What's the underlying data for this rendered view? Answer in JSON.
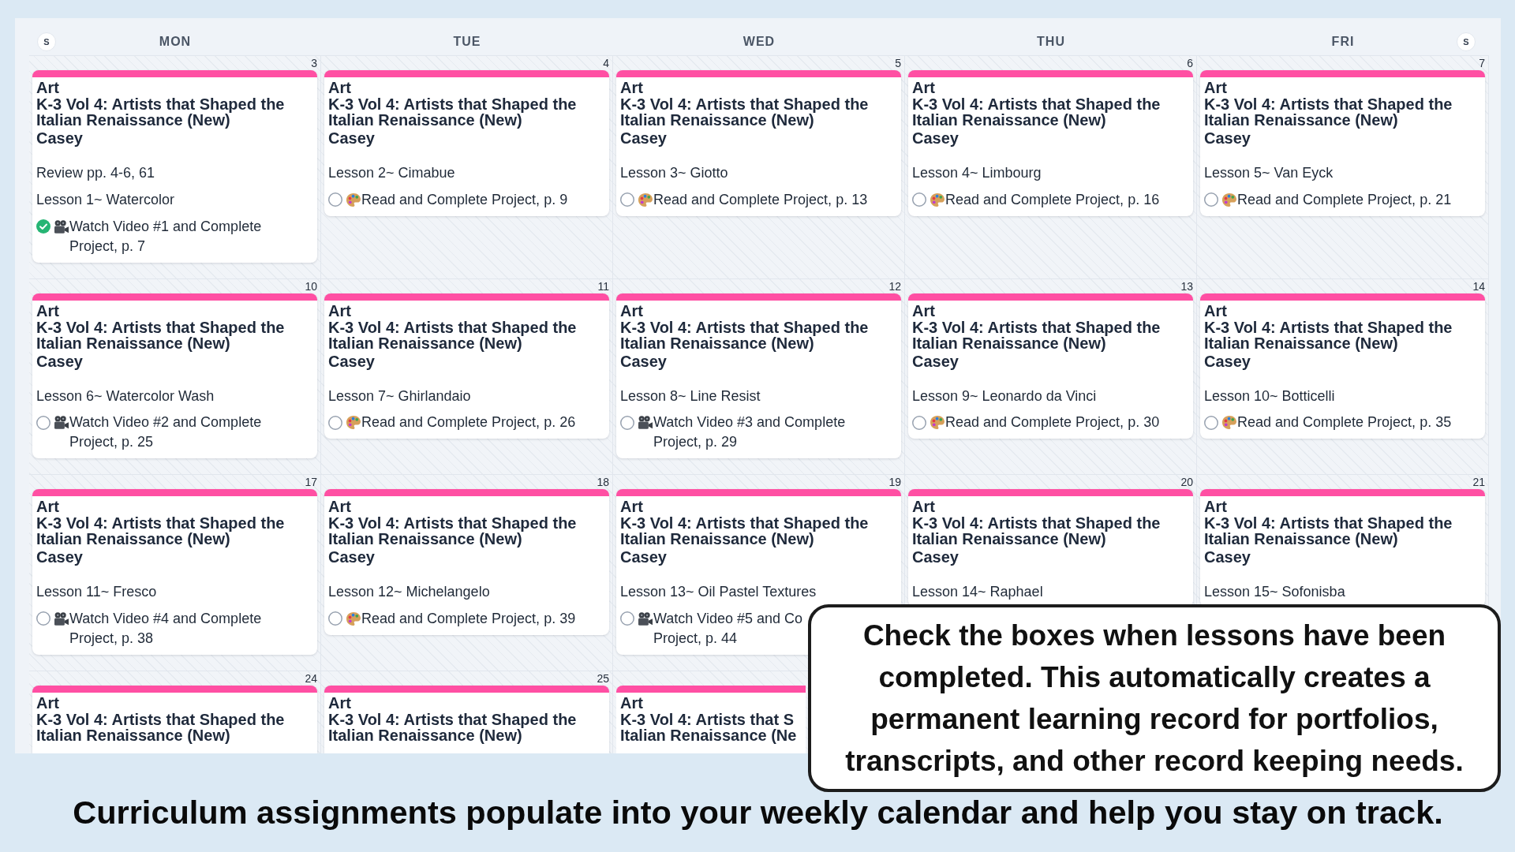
{
  "header": {
    "weekend_left": "S",
    "days": [
      "MON",
      "TUE",
      "WED",
      "THU",
      "FRI"
    ],
    "weekend_right": "S"
  },
  "weeks": [
    {
      "days": [
        {
          "date": "3",
          "events": [
            {
              "subject": "Art",
              "course": "K-3 Vol 4: Artists that Shaped the Italian Renaissance (New)",
              "student": "Casey",
              "notes": [
                "Review pp. 4-6, 61",
                "Lesson 1~ Watercolor"
              ],
              "task": {
                "kind": "video",
                "text": "Watch Video #1 and Complete Project, p. 7",
                "checked": true
              }
            }
          ]
        },
        {
          "date": "4",
          "events": [
            {
              "subject": "Art",
              "course": "K-3 Vol 4: Artists that Shaped the Italian Renaissance (New)",
              "student": "Casey",
              "notes": [
                "Lesson 2~ Cimabue"
              ],
              "task": {
                "kind": "palette",
                "text": "Read and Complete Project, p. 9",
                "checked": false
              }
            }
          ]
        },
        {
          "date": "5",
          "events": [
            {
              "subject": "Art",
              "course": "K-3 Vol 4: Artists that Shaped the Italian Renaissance (New)",
              "student": "Casey",
              "notes": [
                "Lesson 3~ Giotto"
              ],
              "task": {
                "kind": "palette",
                "text": "Read and Complete Project, p. 13",
                "checked": false
              }
            }
          ]
        },
        {
          "date": "6",
          "events": [
            {
              "subject": "Art",
              "course": "K-3 Vol 4: Artists that Shaped the Italian Renaissance (New)",
              "student": "Casey",
              "notes": [
                "Lesson 4~ Limbourg"
              ],
              "task": {
                "kind": "palette",
                "text": "Read and Complete Project, p. 16",
                "checked": false
              }
            }
          ]
        },
        {
          "date": "7",
          "events": [
            {
              "subject": "Art",
              "course": "K-3 Vol 4: Artists that Shaped the Italian Renaissance (New)",
              "student": "Casey",
              "notes": [
                "Lesson 5~ Van Eyck"
              ],
              "task": {
                "kind": "palette",
                "text": "Read and Complete Project, p. 21",
                "checked": false
              }
            }
          ]
        }
      ]
    },
    {
      "days": [
        {
          "date": "10",
          "events": [
            {
              "subject": "Art",
              "course": "K-3 Vol 4: Artists that Shaped the Italian Renaissance (New)",
              "student": "Casey",
              "notes": [
                "Lesson 6~ Watercolor Wash"
              ],
              "task": {
                "kind": "video",
                "text": "Watch Video #2 and Complete Project, p. 25",
                "checked": false
              }
            }
          ]
        },
        {
          "date": "11",
          "events": [
            {
              "subject": "Art",
              "course": "K-3 Vol 4: Artists that Shaped the Italian Renaissance (New)",
              "student": "Casey",
              "notes": [
                "Lesson 7~ Ghirlandaio"
              ],
              "task": {
                "kind": "palette",
                "text": "Read and Complete Project, p. 26",
                "checked": false
              }
            }
          ]
        },
        {
          "date": "12",
          "events": [
            {
              "subject": "Art",
              "course": "K-3 Vol 4: Artists that Shaped the Italian Renaissance (New)",
              "student": "Casey",
              "notes": [
                "Lesson 8~ Line Resist"
              ],
              "task": {
                "kind": "video",
                "text": "Watch Video #3 and Complete Project, p. 29",
                "checked": false
              }
            }
          ]
        },
        {
          "date": "13",
          "events": [
            {
              "subject": "Art",
              "course": "K-3 Vol 4: Artists that Shaped the Italian Renaissance (New)",
              "student": "Casey",
              "notes": [
                "Lesson 9~ Leonardo da Vinci"
              ],
              "task": {
                "kind": "palette",
                "text": "Read and Complete Project, p. 30",
                "checked": false
              }
            }
          ]
        },
        {
          "date": "14",
          "events": [
            {
              "subject": "Art",
              "course": "K-3 Vol 4: Artists that Shaped the Italian Renaissance (New)",
              "student": "Casey",
              "notes": [
                "Lesson 10~ Botticelli"
              ],
              "task": {
                "kind": "palette",
                "text": "Read and Complete Project, p. 35",
                "checked": false
              }
            }
          ]
        }
      ]
    },
    {
      "days": [
        {
          "date": "17",
          "events": [
            {
              "subject": "Art",
              "course": "K-3 Vol 4: Artists that Shaped the Italian Renaissance (New)",
              "student": "Casey",
              "notes": [
                "Lesson 11~ Fresco"
              ],
              "task": {
                "kind": "video",
                "text": "Watch Video #4 and Complete Project, p. 38",
                "checked": false
              }
            }
          ]
        },
        {
          "date": "18",
          "events": [
            {
              "subject": "Art",
              "course": "K-3 Vol 4: Artists that Shaped the Italian Renaissance (New)",
              "student": "Casey",
              "notes": [
                "Lesson 12~ Michelangelo"
              ],
              "task": {
                "kind": "palette",
                "text": "Read and Complete Project, p. 39",
                "checked": false
              }
            }
          ]
        },
        {
          "date": "19",
          "events": [
            {
              "subject": "Art",
              "course": "K-3 Vol 4: Artists that Shaped the Italian Renaissance (New)",
              "student": "Casey",
              "notes": [
                "Lesson 13~ Oil Pastel Textures"
              ],
              "task": {
                "kind": "video",
                "text": "Watch Video #5 and Co\nProject, p. 44",
                "checked": false
              }
            }
          ]
        },
        {
          "date": "20",
          "events": [
            {
              "subject": "Art",
              "course": "K-3 Vol 4: Artists that Shaped the Italian Renaissance (New)",
              "student": "Casey",
              "notes": [
                "Lesson 14~ Raphael"
              ]
            }
          ]
        },
        {
          "date": "21",
          "events": [
            {
              "subject": "Art",
              "course": "K-3 Vol 4: Artists that Shaped the Italian Renaissance (New)",
              "student": "Casey",
              "notes": [
                "Lesson 15~ Sofonisba"
              ]
            }
          ]
        }
      ]
    },
    {
      "days": [
        {
          "date": "24",
          "events": [
            {
              "subject": "Art",
              "course": "K-3 Vol 4: Artists that Shaped the Italian Renaissance (New)"
            }
          ]
        },
        {
          "date": "25",
          "events": [
            {
              "subject": "Art",
              "course": "K-3 Vol 4: Artists that Shaped the Italian Renaissance (New)"
            }
          ]
        },
        {
          "events": [
            {
              "subject": "Art",
              "course": "K-3 Vol 4: Artists that S\nItalian Renaissance (Ne"
            }
          ]
        }
      ]
    }
  ],
  "callout": "Check the boxes when lessons have been completed. This automatically creates a permanent learning record for portfolios, transcripts, and other record keeping needs.",
  "caption": "Curriculum assignments populate into your weekly calendar and help you stay on track."
}
